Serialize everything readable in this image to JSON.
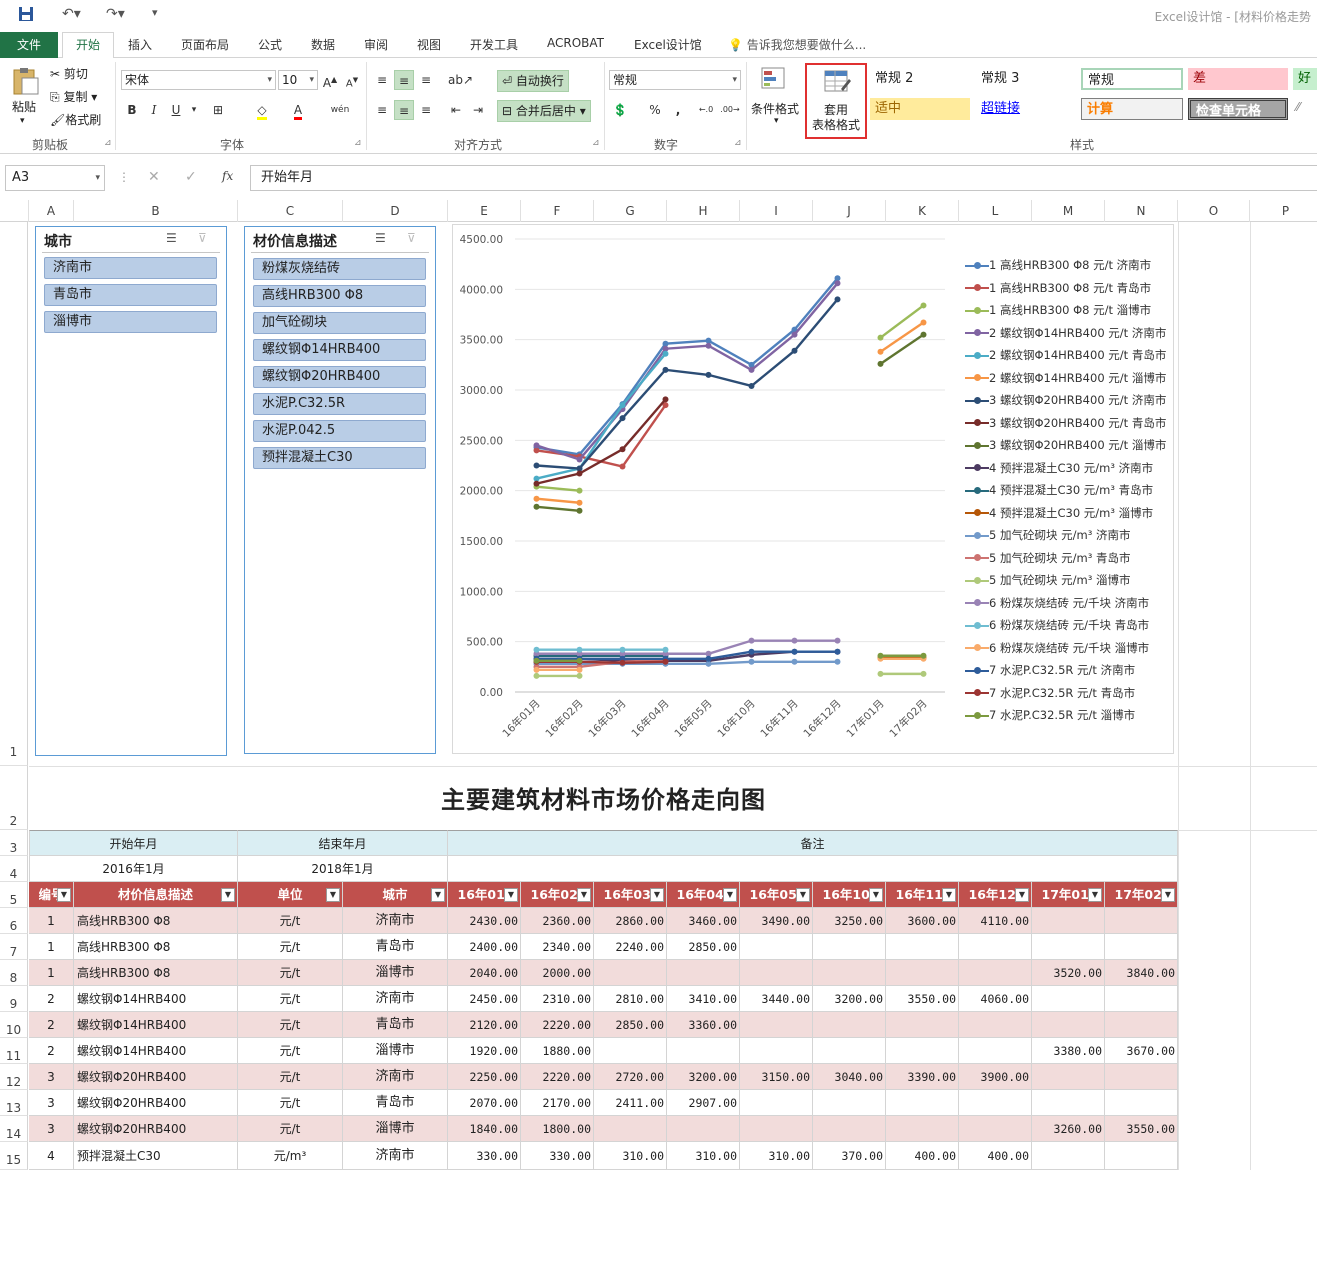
{
  "window": {
    "title": "Excel设计馆 - [材料价格走势"
  },
  "tabs": [
    "文件",
    "开始",
    "插入",
    "页面布局",
    "公式",
    "数据",
    "审阅",
    "视图",
    "开发工具",
    "ACROBAT",
    "Excel设计馆"
  ],
  "tell_me": "告诉我您想要做什么...",
  "ribbon": {
    "clipboard": {
      "paste": "粘贴",
      "cut": "剪切",
      "copy": "复制",
      "format_painter": "格式刷",
      "label": "剪贴板"
    },
    "font": {
      "name": "宋体",
      "size": "10",
      "bold": "B",
      "italic": "I",
      "underline": "U",
      "label": "字体"
    },
    "align": {
      "wrap": "自动换行",
      "merge": "合并后居中",
      "label": "对齐方式"
    },
    "number": {
      "format": "常规",
      "label": "数字"
    },
    "styles": {
      "cond": "条件格式",
      "table_fmt": "套用\n表格格式",
      "label": "样式",
      "cells": [
        "常规 2",
        "常规 3",
        "常规",
        "差",
        "好",
        "适中",
        "超链接",
        "计算",
        "检查单元格"
      ]
    }
  },
  "formula": {
    "cell": "A3",
    "fx": "fx",
    "content": "开始年月"
  },
  "columns": [
    "A",
    "B",
    "C",
    "D",
    "E",
    "F",
    "G",
    "H",
    "I",
    "J",
    "K",
    "L",
    "M",
    "N",
    "O",
    "P"
  ],
  "slicer_city": {
    "title": "城市",
    "items": [
      "济南市",
      "青岛市",
      "淄博市"
    ]
  },
  "slicer_material": {
    "title": "材价信息描述",
    "items": [
      "粉煤灰烧结砖",
      "高线HRB300 Φ8",
      "加气砼砌块",
      "螺纹钢Φ14HRB400",
      "螺纹钢Φ20HRB400",
      "水泥P.C32.5R",
      "水泥P.042.5",
      "预拌混凝土C30"
    ]
  },
  "sheet_title": "主要建筑材料市场价格走向图",
  "params": {
    "start_label": "开始年月",
    "end_label": "结束年月",
    "note_label": "备注",
    "start_value": "2016年1月",
    "end_value": "2018年1月"
  },
  "table": {
    "headers": [
      "编号",
      "材价信息描述",
      "单位",
      "城市",
      "16年01月",
      "16年02月",
      "16年03月",
      "16年04月",
      "16年05月",
      "16年10月",
      "16年11月",
      "16年12月",
      "17年01月",
      "17年02月"
    ],
    "rows": [
      [
        "1",
        "高线HRB300 Φ8",
        "元/t",
        "济南市",
        "2430.00",
        "2360.00",
        "2860.00",
        "3460.00",
        "3490.00",
        "3250.00",
        "3600.00",
        "4110.00",
        "",
        ""
      ],
      [
        "1",
        "高线HRB300 Φ8",
        "元/t",
        "青岛市",
        "2400.00",
        "2340.00",
        "2240.00",
        "2850.00",
        "",
        "",
        "",
        "",
        "",
        ""
      ],
      [
        "1",
        "高线HRB300 Φ8",
        "元/t",
        "淄博市",
        "2040.00",
        "2000.00",
        "",
        "",
        "",
        "",
        "",
        "",
        "3520.00",
        "3840.00"
      ],
      [
        "2",
        "螺纹钢Φ14HRB400",
        "元/t",
        "济南市",
        "2450.00",
        "2310.00",
        "2810.00",
        "3410.00",
        "3440.00",
        "3200.00",
        "3550.00",
        "4060.00",
        "",
        ""
      ],
      [
        "2",
        "螺纹钢Φ14HRB400",
        "元/t",
        "青岛市",
        "2120.00",
        "2220.00",
        "2850.00",
        "3360.00",
        "",
        "",
        "",
        "",
        "",
        ""
      ],
      [
        "2",
        "螺纹钢Φ14HRB400",
        "元/t",
        "淄博市",
        "1920.00",
        "1880.00",
        "",
        "",
        "",
        "",
        "",
        "",
        "3380.00",
        "3670.00"
      ],
      [
        "3",
        "螺纹钢Φ20HRB400",
        "元/t",
        "济南市",
        "2250.00",
        "2220.00",
        "2720.00",
        "3200.00",
        "3150.00",
        "3040.00",
        "3390.00",
        "3900.00",
        "",
        ""
      ],
      [
        "3",
        "螺纹钢Φ20HRB400",
        "元/t",
        "青岛市",
        "2070.00",
        "2170.00",
        "2411.00",
        "2907.00",
        "",
        "",
        "",
        "",
        "",
        ""
      ],
      [
        "3",
        "螺纹钢Φ20HRB400",
        "元/t",
        "淄博市",
        "1840.00",
        "1800.00",
        "",
        "",
        "",
        "",
        "",
        "",
        "3260.00",
        "3550.00"
      ],
      [
        "4",
        "预拌混凝土C30",
        "元/m³",
        "济南市",
        "330.00",
        "330.00",
        "310.00",
        "310.00",
        "310.00",
        "370.00",
        "400.00",
        "400.00",
        "",
        ""
      ]
    ]
  },
  "row_numbers": [
    "1",
    "2",
    "3",
    "4",
    "5",
    "6",
    "7",
    "8",
    "9",
    "10",
    "11",
    "12",
    "13",
    "14",
    "15"
  ],
  "chart_data": {
    "type": "line",
    "categories": [
      "16年01月",
      "16年02月",
      "16年03月",
      "16年04月",
      "16年05月",
      "16年10月",
      "16年11月",
      "16年12月",
      "17年01月",
      "17年02月"
    ],
    "ylim": [
      0,
      4500
    ],
    "yticks": [
      "0.00",
      "500.00",
      "1000.00",
      "1500.00",
      "2000.00",
      "2500.00",
      "3000.00",
      "3500.00",
      "4000.00",
      "4500.00"
    ],
    "series": [
      {
        "name": "1 高线HRB300 Φ8 元/t 济南市",
        "color": "#4f81bd",
        "values": [
          2430,
          2360,
          2860,
          3460,
          3490,
          3250,
          3600,
          4110,
          null,
          null
        ]
      },
      {
        "name": "1 高线HRB300 Φ8 元/t 青岛市",
        "color": "#c0504d",
        "values": [
          2400,
          2340,
          2240,
          2850,
          null,
          null,
          null,
          null,
          null,
          null
        ]
      },
      {
        "name": "1 高线HRB300 Φ8 元/t 淄博市",
        "color": "#9bbb59",
        "values": [
          2040,
          2000,
          null,
          null,
          null,
          null,
          null,
          null,
          3520,
          3840
        ]
      },
      {
        "name": "2 螺纹钢Φ14HRB400 元/t 济南市",
        "color": "#8064a2",
        "values": [
          2450,
          2310,
          2810,
          3410,
          3440,
          3200,
          3550,
          4060,
          null,
          null
        ]
      },
      {
        "name": "2 螺纹钢Φ14HRB400 元/t 青岛市",
        "color": "#4bacc6",
        "values": [
          2120,
          2220,
          2850,
          3360,
          null,
          null,
          null,
          null,
          null,
          null
        ]
      },
      {
        "name": "2 螺纹钢Φ14HRB400 元/t 淄博市",
        "color": "#f79646",
        "values": [
          1920,
          1880,
          null,
          null,
          null,
          null,
          null,
          null,
          3380,
          3670
        ]
      },
      {
        "name": "3 螺纹钢Φ20HRB400 元/t 济南市",
        "color": "#2c4d75",
        "values": [
          2250,
          2220,
          2720,
          3200,
          3150,
          3040,
          3390,
          3900,
          null,
          null
        ]
      },
      {
        "name": "3 螺纹钢Φ20HRB400 元/t 青岛市",
        "color": "#772c2a",
        "values": [
          2070,
          2170,
          2411,
          2907,
          null,
          null,
          null,
          null,
          null,
          null
        ]
      },
      {
        "name": "3 螺纹钢Φ20HRB400 元/t 淄博市",
        "color": "#5f7530",
        "values": [
          1840,
          1800,
          null,
          null,
          null,
          null,
          null,
          null,
          3260,
          3550
        ]
      },
      {
        "name": "4 预拌混凝土C30 元/m³ 济南市",
        "color": "#4d3b62",
        "values": [
          330,
          330,
          310,
          310,
          310,
          370,
          400,
          400,
          null,
          null
        ]
      },
      {
        "name": "4 预拌混凝土C30 元/m³ 青岛市",
        "color": "#276a7c",
        "values": [
          360,
          360,
          360,
          360,
          null,
          null,
          null,
          null,
          null,
          null
        ]
      },
      {
        "name": "4 预拌混凝土C30 元/m³ 淄博市",
        "color": "#b65708",
        "values": [
          300,
          300,
          null,
          null,
          null,
          null,
          null,
          null,
          340,
          340
        ]
      },
      {
        "name": "5 加气砼砌块 元/m³ 济南市",
        "color": "#729aca",
        "values": [
          280,
          280,
          280,
          280,
          280,
          300,
          300,
          300,
          null,
          null
        ]
      },
      {
        "name": "5 加气砼砌块 元/m³ 青岛市",
        "color": "#cd7371",
        "values": [
          250,
          250,
          300,
          320,
          null,
          null,
          null,
          null,
          null,
          null
        ]
      },
      {
        "name": "5 加气砼砌块 元/m³ 淄博市",
        "color": "#afc97a",
        "values": [
          160,
          160,
          null,
          null,
          null,
          null,
          null,
          null,
          180,
          180
        ]
      },
      {
        "name": "6 粉煤灰烧结砖 元/千块 济南市",
        "color": "#9983b5",
        "values": [
          380,
          380,
          380,
          380,
          380,
          510,
          510,
          510,
          null,
          null
        ]
      },
      {
        "name": "6 粉煤灰烧结砖 元/千块 青岛市",
        "color": "#6fbdd1",
        "values": [
          420,
          420,
          420,
          420,
          null,
          null,
          null,
          null,
          null,
          null
        ]
      },
      {
        "name": "6 粉煤灰烧结砖 元/千块 淄博市",
        "color": "#f9ab6b",
        "values": [
          220,
          220,
          null,
          null,
          null,
          null,
          null,
          null,
          330,
          330
        ]
      },
      {
        "name": "7 水泥P.C32.5R 元/t 济南市",
        "color": "#2e5c9a",
        "values": [
          330,
          330,
          330,
          330,
          330,
          400,
          400,
          400,
          null,
          null
        ]
      },
      {
        "name": "7 水泥P.C32.5R 元/t 青岛市",
        "color": "#9c3533",
        "values": [
          300,
          300,
          290,
          300,
          null,
          null,
          null,
          null,
          null,
          null
        ]
      },
      {
        "name": "7 水泥P.C32.5R 元/t 淄博市",
        "color": "#7c9a3f",
        "values": [
          310,
          310,
          null,
          null,
          null,
          null,
          null,
          null,
          360,
          360
        ]
      }
    ]
  }
}
